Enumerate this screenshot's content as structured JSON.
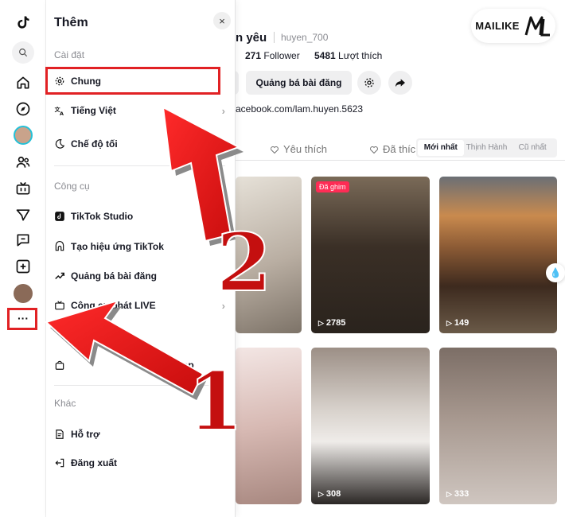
{
  "drawer": {
    "title": "Thêm",
    "close": "×",
    "settings_section": "Cài đặt",
    "settings_items": [
      {
        "label": "Chung",
        "icon": "gear-icon"
      },
      {
        "label": "Tiếng Việt",
        "icon": "translate-icon",
        "chevron": "›"
      },
      {
        "label": "Chế độ tối",
        "icon": "moon-icon"
      }
    ],
    "tools_section": "Công cụ",
    "tools_items": [
      {
        "label": "TikTok Studio",
        "icon": "studio-icon"
      },
      {
        "label": "Tạo hiệu ứng TikTok",
        "icon": "effect-icon"
      },
      {
        "label": "Quảng bá bài đăng",
        "icon": "trend-icon"
      },
      {
        "label": "Công cụ phát LIVE",
        "icon": "live-tv-icon",
        "chevron": "›"
      },
      {
        "label": "op",
        "icon": "shop-bag-icon"
      }
    ],
    "other_section": "Khác",
    "other_items": [
      {
        "label": "Hỗ trợ",
        "icon": "help-doc-icon"
      },
      {
        "label": "Đăng xuất",
        "icon": "logout-icon"
      }
    ]
  },
  "rail": {
    "more_label": "···"
  },
  "profile": {
    "name": "n yêu",
    "username": "huyen_700",
    "followers": "271",
    "followers_label": "Follower",
    "likes": "5481",
    "likes_label": "Lượt thích",
    "promote_button": "Quảng bá bài đăng",
    "link": "acebook.com/lam.huyen.5623"
  },
  "tabs": {
    "liked": "Yêu thích",
    "liked2": "Đã thích",
    "sort": [
      "Mới nhất",
      "Thịnh Hành",
      "Cũ nhất"
    ]
  },
  "videos": [
    {
      "views": "",
      "pinned": ""
    },
    {
      "views": "2785",
      "pinned": "Đã ghim"
    },
    {
      "views": "149",
      "pinned": ""
    },
    {
      "views": "",
      "pinned": ""
    },
    {
      "views": "308",
      "pinned": ""
    },
    {
      "views": "333",
      "pinned": ""
    }
  ],
  "watermark": {
    "text": "MAILIKE",
    "mark": "ML"
  },
  "annotations": {
    "step1": "1",
    "step2": "2"
  },
  "colors": {
    "accent": "#e12124",
    "tiktok_pink": "#fe2c55",
    "text": "#161823",
    "muted": "#8a8b91"
  }
}
